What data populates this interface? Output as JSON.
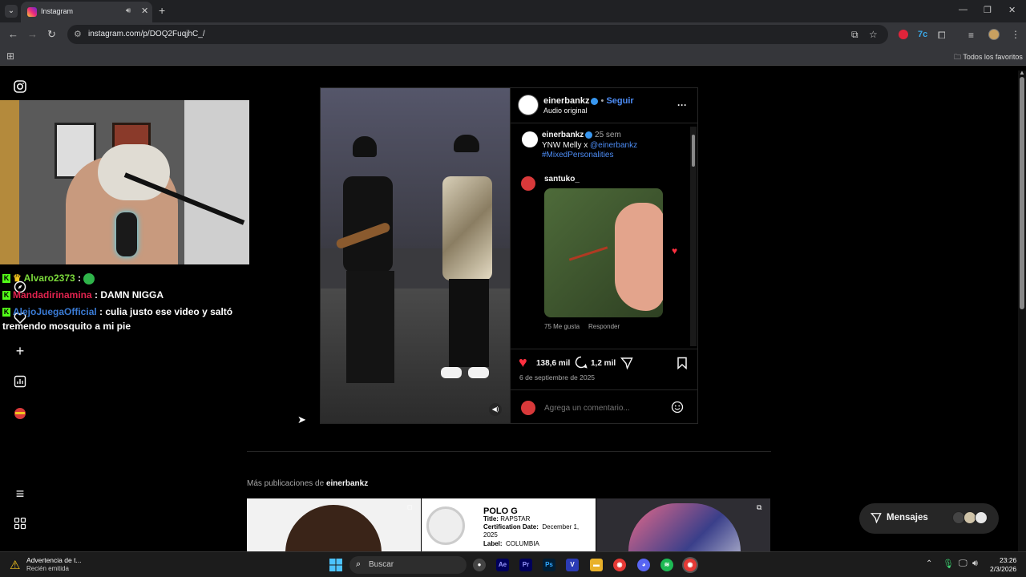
{
  "browser": {
    "tab_title": "Instagram",
    "url": "instagram.com/p/DOQ2FuqjhC_/",
    "bookmarks_folder": "Todos los favoritos"
  },
  "chat": {
    "lines": [
      {
        "user": "Alvaro2373",
        "sep": " :",
        "text": "",
        "user_color": "#7cdc3c"
      },
      {
        "user": "Mandadirinamina",
        "sep": " :",
        "text": " DAMN NIGGA",
        "user_color": "#e0234e"
      },
      {
        "user": "AlejoJuegaOfficial",
        "sep": " :",
        "text": " culia justo ese video y saltó",
        "user_color": "#3a7bd5"
      }
    ],
    "wrap_text": "tremendo mosquito a mi pie"
  },
  "post": {
    "author": "einerbankz",
    "follow": "Seguir",
    "audio": "Audio original",
    "caption_time": "25 sem",
    "caption_text": "YNW Melly x ",
    "caption_mention": "@einerbankz",
    "caption_hashtag": "#MixedPersonalities",
    "comment_user": "santuko_",
    "comment_likes": "75 Me gusta",
    "comment_reply": "Responder",
    "likes": "138,6 mil",
    "comments": "1,2 mil",
    "date": "6 de septiembre de 2025",
    "add_comment_placeholder": "Agrega un comentario...",
    "more_label": "···"
  },
  "more_posts": {
    "prefix": "Más publicaciones de ",
    "author": "einerbankz",
    "cert": {
      "artist": "POLO G",
      "title_label": "Title:",
      "title_value": "RAPSTAR",
      "date_label": "Certification Date:",
      "date_value": "December 1,",
      "date_year": "2025",
      "label_label": "Label:",
      "label_value": "COLUMBIA"
    }
  },
  "messages": {
    "label": "Mensajes"
  },
  "taskbar": {
    "notification_title": "Advertencia de t...",
    "notification_sub": "Recién emitida",
    "search": "Buscar",
    "time": "23:26",
    "date": "2/3/2026"
  },
  "colors": {
    "instagram_blue": "#4d8df6",
    "like_red": "#ff3040",
    "kick_green": "#53fc18"
  }
}
